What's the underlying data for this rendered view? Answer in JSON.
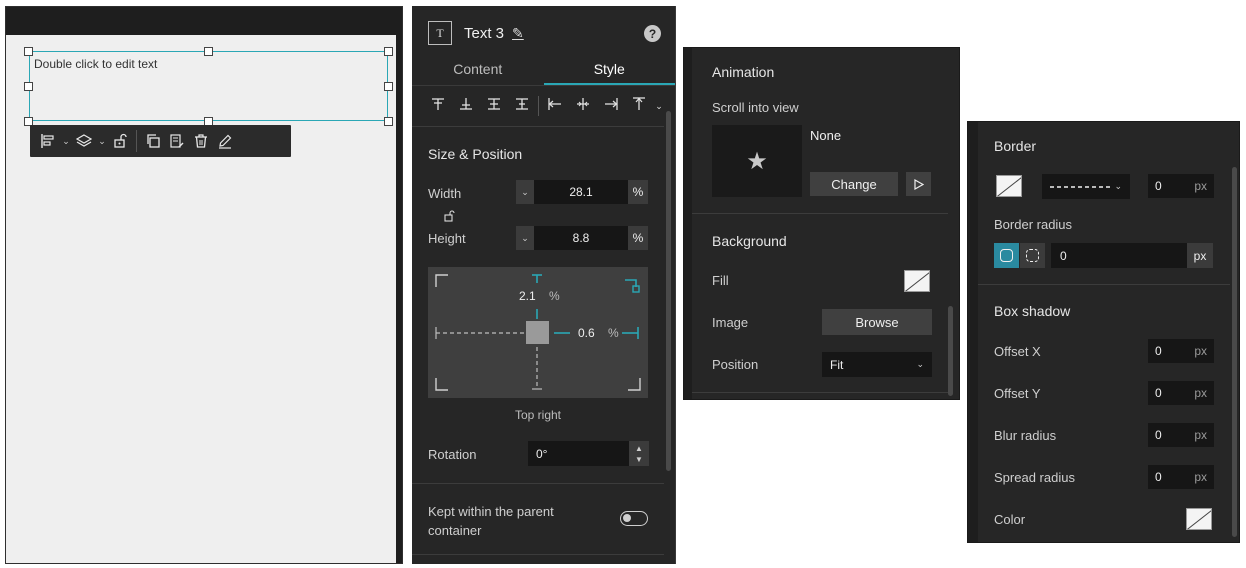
{
  "canvas": {
    "text_placeholder": "Double click to edit text"
  },
  "style_panel": {
    "title": "Text 3",
    "tabs": [
      {
        "label": "Content",
        "active": false
      },
      {
        "label": "Style",
        "active": true
      }
    ],
    "size_position": {
      "section_title": "Size & Position",
      "width_label": "Width",
      "width_value": "28.1",
      "width_unit": "%",
      "height_label": "Height",
      "height_value": "8.8",
      "height_unit": "%",
      "top_offset": "2.1",
      "top_unit": "%",
      "right_offset": "0.6",
      "right_unit": "%",
      "anchor_caption": "Top right",
      "rotation_label": "Rotation",
      "rotation_value": "0°"
    },
    "kept_within_label": "Kept within the parent container",
    "kept_within_enabled": false
  },
  "animation_panel": {
    "title": "Animation",
    "scroll_label": "Scroll into view",
    "effect_value": "None",
    "change_button": "Change",
    "background_title": "Background",
    "fill_label": "Fill",
    "image_label": "Image",
    "browse_button": "Browse",
    "position_label": "Position",
    "position_value": "Fit"
  },
  "border_panel": {
    "border_title": "Border",
    "border_width": "0",
    "unit": "px",
    "radius_label": "Border radius",
    "radius_value": "0",
    "box_shadow_title": "Box shadow",
    "offset_x_label": "Offset X",
    "offset_x_value": "0",
    "offset_y_label": "Offset Y",
    "offset_y_value": "0",
    "blur_label": "Blur radius",
    "blur_value": "0",
    "spread_label": "Spread radius",
    "spread_value": "0",
    "color_label": "Color"
  },
  "colors": {
    "accent": "#2aa7b5",
    "panel_bg": "#262626",
    "canvas_bg": "#efefef"
  }
}
